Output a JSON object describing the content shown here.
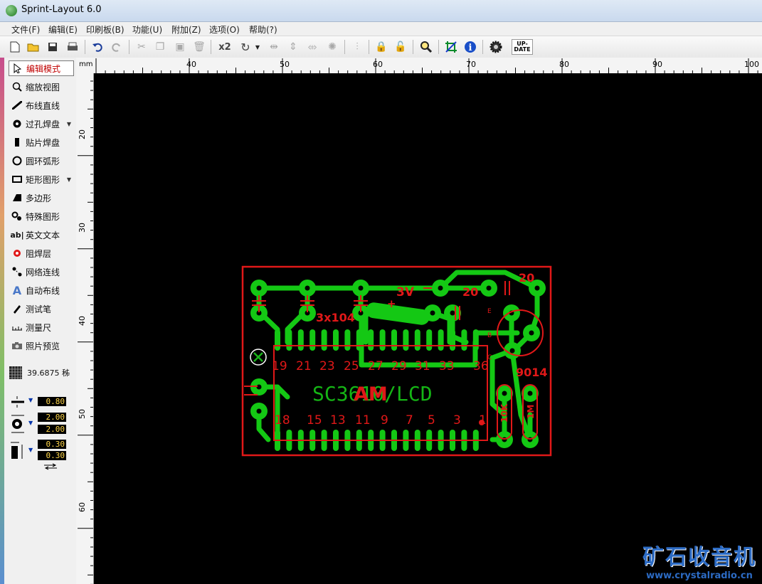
{
  "window": {
    "title": "Sprint-Layout 6.0"
  },
  "menu": [
    "文件(F)",
    "编辑(E)",
    "印刷板(B)",
    "功能(U)",
    "附加(Z)",
    "选项(O)",
    "帮助(?)"
  ],
  "toolbar": {
    "zoom_label": "x2",
    "update_label": "UP-DATE"
  },
  "sidebar": {
    "tools": [
      {
        "label": "编辑模式",
        "icon": "cursor-icon",
        "active": true
      },
      {
        "label": "缩放视图",
        "icon": "magnifier-icon"
      },
      {
        "label": "布线直线",
        "icon": "track-icon"
      },
      {
        "label": "过孔焊盘",
        "icon": "via-pad-icon",
        "dropdown": true
      },
      {
        "label": "贴片焊盘",
        "icon": "smd-pad-icon"
      },
      {
        "label": "圆环弧形",
        "icon": "circle-icon"
      },
      {
        "label": "矩形图形",
        "icon": "rectangle-icon",
        "dropdown": true
      },
      {
        "label": "多边形",
        "icon": "polygon-icon"
      },
      {
        "label": "特殊图形",
        "icon": "special-shape-icon"
      },
      {
        "label": "英文文本",
        "icon": "text-icon"
      },
      {
        "label": "阻焊层",
        "icon": "solder-mask-icon"
      },
      {
        "label": "网络连线",
        "icon": "net-icon"
      },
      {
        "label": "自动布线",
        "icon": "autoroute-icon"
      },
      {
        "label": "测试笔",
        "icon": "test-pen-icon"
      },
      {
        "label": "测量尺",
        "icon": "ruler-icon"
      },
      {
        "label": "照片预览",
        "icon": "camera-icon"
      }
    ],
    "grid_value": "39.6875 秭",
    "track_width": "0.80",
    "pad_outer": "2.00",
    "pad_inner": "2.00",
    "smd_width": "0.30",
    "smd_height": "0.30"
  },
  "ruler": {
    "unit": "mm",
    "top_labels": [
      "40",
      "50",
      "60",
      "70",
      "80",
      "90",
      "100"
    ],
    "left_labels": [
      "20",
      "30",
      "40",
      "50",
      "60"
    ]
  },
  "pcb": {
    "ic_label": "SC3610/LCD",
    "ic_overlay": "AM",
    "top_pin_numbers": [
      "19",
      "21",
      "23",
      "25",
      "27",
      "29",
      "31",
      "33",
      "36"
    ],
    "bottom_pin_numbers": [
      "18",
      "15",
      "13",
      "11",
      "9",
      "7",
      "5",
      "3",
      "1"
    ],
    "labels": {
      "voltage": "3V",
      "caps": "3x104",
      "cap_20a": "20",
      "cap_20b": "20",
      "transistor": "9014",
      "res_1": "10K",
      "res_2": "1M",
      "plus": "+",
      "pin_e": "E",
      "pin_b": "B",
      "pin_c": "C"
    },
    "colors": {
      "copper": "#14c814",
      "silk": "#e01818",
      "ic_text": "#15b515"
    }
  },
  "watermark": {
    "name": "矿石收音机",
    "url": "www.crystalradio.cn"
  }
}
